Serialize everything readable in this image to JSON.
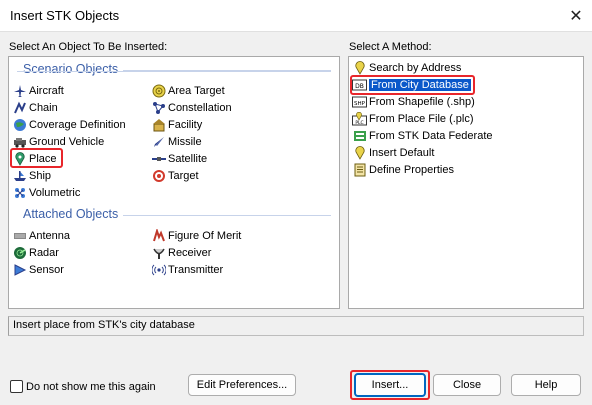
{
  "window": {
    "title": "Insert STK Objects"
  },
  "left": {
    "label": "Select An Object To Be Inserted:",
    "scenario_group": "Scenario Objects",
    "scenario_col1": [
      "Aircraft",
      "Chain",
      "Coverage Definition",
      "Ground Vehicle",
      "Place",
      "Ship",
      "Volumetric"
    ],
    "scenario_col2": [
      "Area Target",
      "Constellation",
      "Facility",
      "Missile",
      "Satellite",
      "Target"
    ],
    "attached_group": "Attached Objects",
    "attached_col1": [
      "Antenna",
      "Radar",
      "Sensor"
    ],
    "attached_col2": [
      "Figure Of Merit",
      "Receiver",
      "Transmitter"
    ],
    "selected": "Place"
  },
  "right": {
    "label": "Select A Method:",
    "methods": [
      "Search by Address",
      "From City Database",
      "From Shapefile (.shp)",
      "From Place File (.plc)",
      "From STK Data Federate",
      "Insert Default",
      "Define Properties"
    ],
    "selected": "From City Database"
  },
  "description": "Insert place from STK's city database",
  "footer": {
    "checkbox_label": "Do not show me this again",
    "checked": false,
    "edit_prefs": "Edit Preferences...",
    "insert": "Insert...",
    "close": "Close",
    "help": "Help"
  },
  "colors": {
    "accent": "#0a58ca",
    "highlight_box": "#e8262b",
    "group_title": "#3b5fa8"
  }
}
